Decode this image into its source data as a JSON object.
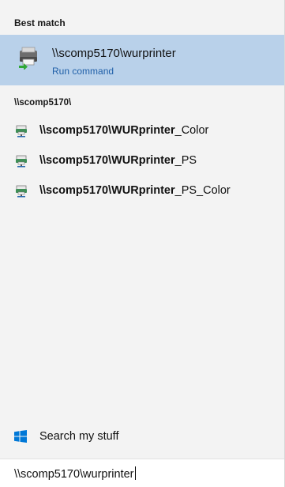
{
  "best_match": {
    "header": "Best match",
    "title": "\\\\scomp5170\\wurprinter",
    "subtitle": "Run command",
    "icon": "printer-run-icon"
  },
  "group": {
    "header": "\\\\scomp5170\\",
    "items": [
      {
        "bold": "\\\\scomp5170\\WURprinter",
        "rest": "_Color",
        "icon": "network-printer-icon"
      },
      {
        "bold": "\\\\scomp5170\\WURprinter",
        "rest": "_PS",
        "icon": "network-printer-icon"
      },
      {
        "bold": "\\\\scomp5170\\WURprinter",
        "rest": "_PS_Color",
        "icon": "network-printer-icon"
      }
    ]
  },
  "search_my_stuff": {
    "label": "Search my stuff",
    "icon": "windows-icon"
  },
  "search_box": {
    "value": "\\\\scomp5170\\wurprinter"
  },
  "colors": {
    "selected_bg": "#b9d1ea",
    "panel_bg": "#f3f3f3",
    "link_blue": "#1f5fa8",
    "windows_blue": "#0078d7"
  }
}
